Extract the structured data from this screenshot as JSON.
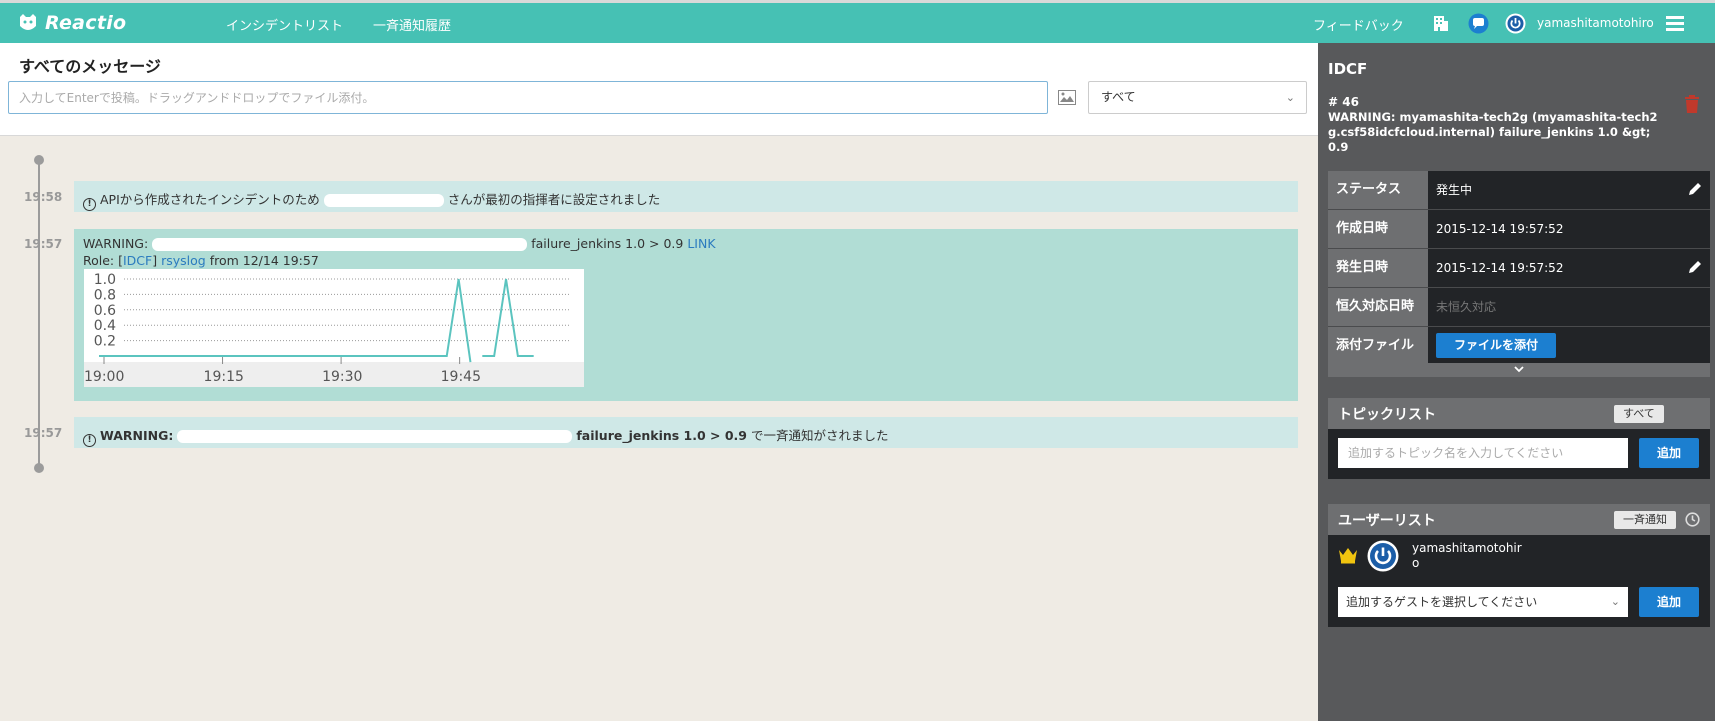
{
  "header": {
    "app_name": "Reactio",
    "nav": [
      "インシデントリスト",
      "一斉通知履歴"
    ],
    "feedback": "フィードバック",
    "username": "yamashitamotohiro"
  },
  "messages": {
    "title": "すべてのメッセージ",
    "input_placeholder": "入力してEnterで投稿。ドラッグアンドドロップでファイル添付。",
    "filter_value": "すべて"
  },
  "timeline": {
    "entry1": {
      "time": "19:58",
      "text_before": "APIから作成されたインシデントのため",
      "text_after": "さんが最初の指揮者に設定されました"
    },
    "entry2": {
      "time": "19:57",
      "warning": "WARNING:",
      "condition": "failure_jenkins 1.0 > 0.9",
      "link": "LINK",
      "role_prefix": "Role: [",
      "role": "IDCF",
      "role_mid": "]",
      "source": "rsyslog",
      "from": "from 12/14 19:57"
    },
    "entry3": {
      "time": "19:57",
      "warning": "WARNING:",
      "condition": "failure_jenkins 1.0 > 0.9",
      "suffix": "で一斉通知がされました"
    }
  },
  "chart_data": {
    "type": "line",
    "x": [
      "19:00",
      "19:15",
      "19:30",
      "19:45"
    ],
    "yticks": [
      "1.0",
      "0.8",
      "0.6",
      "0.4",
      "0.2"
    ],
    "ylim": [
      0,
      1.0
    ],
    "series_color": "#5bc4bf",
    "series": [
      {
        "values_desc": "0 until ~19:45, spike to 1.0 at ~19:45, spike to 1.0 at ~19:51, then 0"
      }
    ]
  },
  "incident": {
    "project": "IDCF",
    "number": "# 46",
    "title": "WARNING: myamashita-tech2g (myamashita-tech2g.csf58idcfcloud.internal) failure_jenkins 1.0 &gt; 0.9",
    "rows": [
      {
        "label": "ステータス",
        "value": "発生中"
      },
      {
        "label": "作成日時",
        "value": "2015-12-14 19:57:52"
      },
      {
        "label": "発生日時",
        "value": "2015-12-14 19:57:52"
      },
      {
        "label": "恒久対応日時",
        "value": "未恒久対応"
      },
      {
        "label": "添付ファイル",
        "value": "ファイルを添付"
      }
    ]
  },
  "topics": {
    "title": "トピックリスト",
    "all_button": "すべて",
    "input_placeholder": "追加するトピック名を入力してください",
    "add": "追加"
  },
  "users": {
    "title": "ユーザーリスト",
    "notify_button": "一斉通知",
    "user_name": "yamashitamotohiro",
    "guest_placeholder": "追加するゲストを選択してください",
    "add": "追加"
  },
  "colors": {
    "header": "#46c1b4",
    "accent_blue": "#1c7fd0",
    "danger": "#c0392b",
    "crown": "#f1c40f"
  }
}
